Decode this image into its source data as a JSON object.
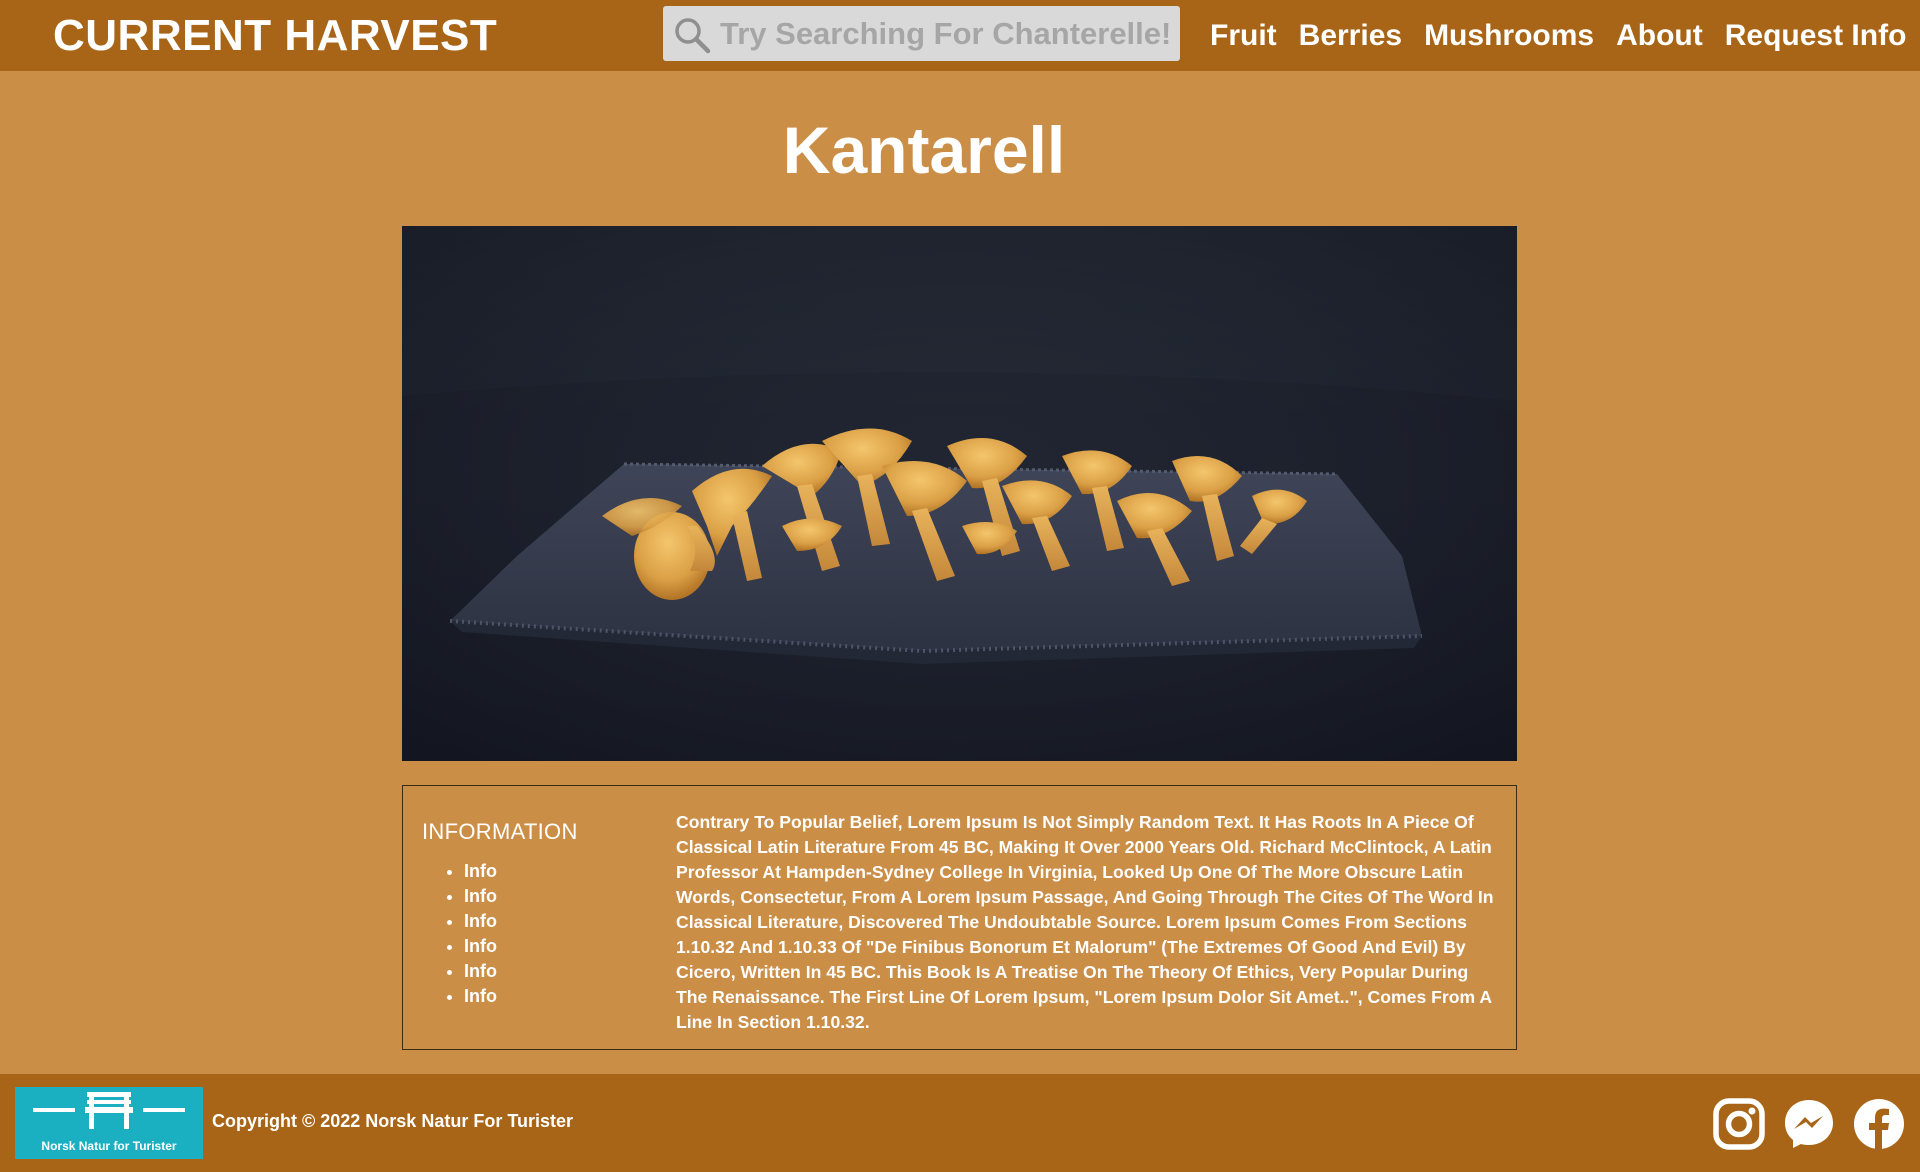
{
  "header": {
    "brand": "CURRENT HARVEST",
    "search": {
      "placeholder": "Try Searching For Chanterelle!"
    },
    "nav": [
      "Fruit",
      "Berries",
      "Mushrooms",
      "About",
      "Request Info"
    ]
  },
  "main": {
    "title": "Kantarell",
    "image_alt": "Chanterelle mushrooms on a dark cloth",
    "info": {
      "heading": "INFORMATION",
      "items": [
        "Info",
        "Info",
        "Info",
        "Info",
        "Info",
        "Info"
      ],
      "text": "Contrary To Popular Belief, Lorem Ipsum Is Not Simply Random Text. It Has Roots In A Piece Of Classical Latin Literature From 45 BC, Making It Over 2000 Years Old. Richard McClintock, A Latin Professor At Hampden-Sydney College In Virginia, Looked Up One Of The More Obscure Latin Words, Consectetur, From A Lorem Ipsum Passage, And Going Through The Cites Of The Word In Classical Literature, Discovered The Undoubtable Source. Lorem Ipsum Comes From Sections 1.10.32 And 1.10.33 Of \"De Finibus Bonorum Et Malorum\" (The Extremes Of Good And Evil) By Cicero, Written In 45 BC. This Book Is A Treatise On The Theory Of Ethics, Very Popular During The Renaissance. The First Line Of Lorem Ipsum, \"Lorem Ipsum Dolor Sit Amet..\", Comes From A Line In Section 1.10.32."
    }
  },
  "footer": {
    "logo_text": "Norsk Natur for Turister",
    "copyright": "Copyright © 2022 Norsk Natur For Turister",
    "social_icons": [
      "instagram-icon",
      "messenger-icon",
      "facebook-icon"
    ]
  },
  "colors": {
    "header_bg": "#a86517",
    "page_bg": "#cb8e47",
    "logo_bg": "#1ab0c2",
    "text": "#ffffff"
  }
}
